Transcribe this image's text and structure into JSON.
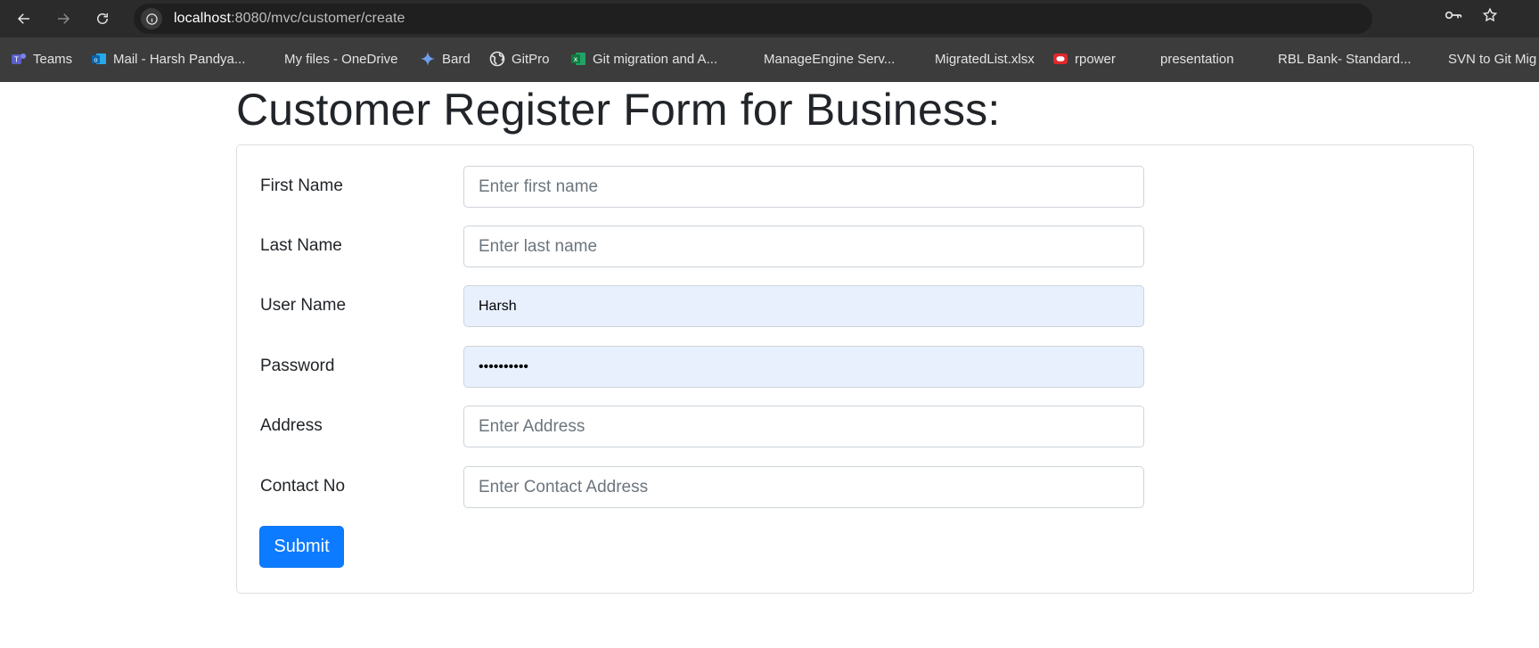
{
  "browser": {
    "url_host": "localhost",
    "url_path": ":8080/mvc/customer/create",
    "bookmarks": [
      {
        "label": "Teams",
        "icon": "teams-icon"
      },
      {
        "label": "Mail - Harsh Pandya...",
        "icon": "outlook-icon"
      },
      {
        "label": "My files - OneDrive",
        "icon": "microsoft-icon"
      },
      {
        "label": "Bard",
        "icon": "bard-icon"
      },
      {
        "label": "GitPro",
        "icon": "globe-icon"
      },
      {
        "label": "Git migration and A...",
        "icon": "excel-icon"
      },
      {
        "label": "ManageEngine Serv...",
        "icon": "microsoft-icon"
      },
      {
        "label": "MigratedList.xlsx",
        "icon": "microsoft-icon"
      },
      {
        "label": "rpower",
        "icon": "oracle-icon"
      },
      {
        "label": "presentation",
        "icon": "microsoft-icon"
      },
      {
        "label": "RBL Bank- Standard...",
        "icon": "microsoft-icon"
      },
      {
        "label": "SVN to Git Mig",
        "icon": "microsoft-icon"
      }
    ]
  },
  "page": {
    "title": "Customer Register Form for Business:",
    "form": {
      "first_name": {
        "label": "First Name",
        "placeholder": "Enter first name",
        "value": ""
      },
      "last_name": {
        "label": "Last Name",
        "placeholder": "Enter last name",
        "value": ""
      },
      "user_name": {
        "label": "User Name",
        "placeholder": "",
        "value": "Harsh"
      },
      "password": {
        "label": "Password",
        "placeholder": "",
        "value": "••••••••••"
      },
      "address": {
        "label": "Address",
        "placeholder": "Enter Address",
        "value": ""
      },
      "contact_no": {
        "label": "Contact No",
        "placeholder": "Enter Contact Address",
        "value": ""
      },
      "submit_label": "Submit"
    }
  },
  "colors": {
    "primary": "#0d7bff",
    "autofill_bg": "#e8f0fe",
    "text": "#212529"
  }
}
